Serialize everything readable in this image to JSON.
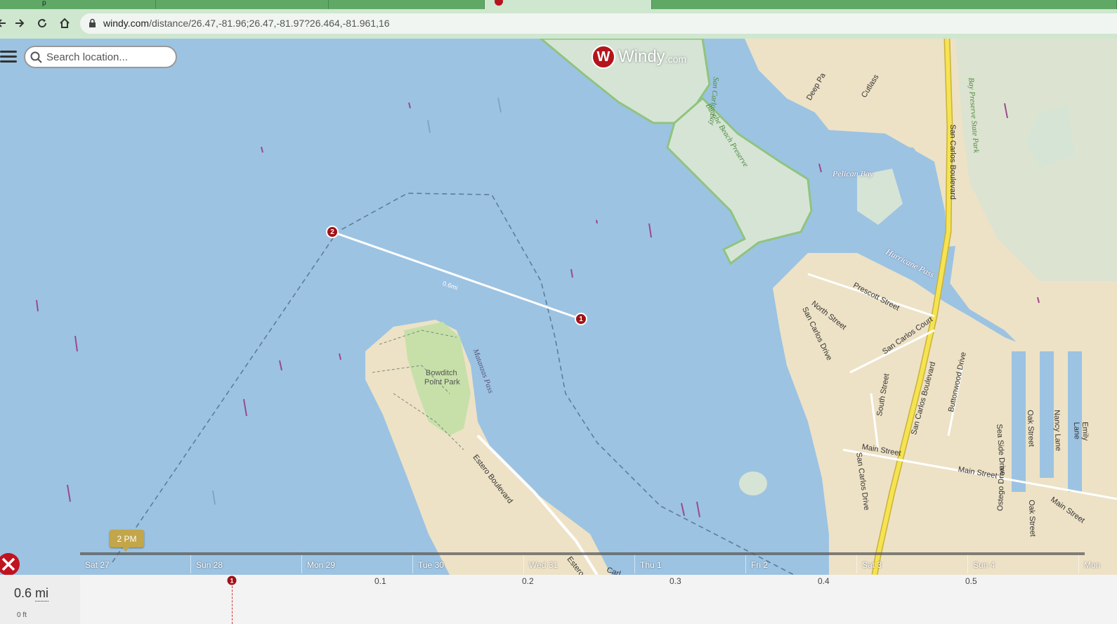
{
  "browser": {
    "tabs": [
      {
        "label": "p"
      },
      {
        "label": ""
      },
      {
        "label": ""
      },
      {
        "label": ""
      },
      {
        "label": ""
      }
    ],
    "url_host": "windy.com",
    "url_path": "/distance/26.47,-81.96;26.47,-81.97?26.464,-81.961,16"
  },
  "map": {
    "search_placeholder": "Search location...",
    "logo_text": "Windy",
    "logo_suffix": ".com",
    "line_distance_label": "0.6mi",
    "marker1": "1",
    "marker2": "2",
    "place_labels": {
      "bowditch": "Bowditch",
      "point_park": "Point Park",
      "matanzas_pass": "Matanzas Pass",
      "estero_blvd": "Estero Boulevard",
      "estero": "Estero",
      "pelican_bay": "Pelican Bay",
      "hurricane_pass": "Hurricane Pass",
      "san_carlos_bay": "San Carlos Bay",
      "bunche_beach": "Bunche Beach Preserve",
      "bay_preserve": "Bay Preserve State Park",
      "san_carlos_blvd_north": "San Carlos Boulevard",
      "san_carlos_blvd_south": "San Carlos Boulevard",
      "prescott_st": "Prescott Street",
      "north_st": "North Street",
      "san_carlos_court": "San Carlos Court",
      "san_carlos_drive": "San Carlos Drive",
      "san_carlos_drive2": "San Carlos Drive",
      "south_st": "South Street",
      "main_st": "Main Street",
      "main_st2": "Main Street",
      "main_st3": "Main Street",
      "buttonwood": "Buttonwood Drive",
      "oak_st": "Oak Street",
      "oak_st2": "Oak Street",
      "nancy_lane": "Nancy Lane",
      "emily_lane": "Emily Lane",
      "sea_side": "Sea Side Drive",
      "ostego": "Ostego Drive",
      "deep_pass": "Deep Pa",
      "cutlass": "Cutlass",
      "carl": "Carl"
    },
    "time_badge": "2 PM",
    "days": [
      "Sat 27",
      "Sun 28",
      "Mon 29",
      "Tue 30",
      "Wed 31",
      "Thu 1",
      "Fri 2",
      "Sat 3",
      "Sun 4",
      "Mon"
    ]
  },
  "profile": {
    "distance_value": "0.6",
    "distance_unit": "mi",
    "elevation_label": "0 ft",
    "scale": [
      "0.1",
      "0.2",
      "0.3",
      "0.4",
      "0.5"
    ],
    "marker": "1"
  },
  "colors": {
    "water": "#9dc3e2",
    "land": "#eee2c6",
    "park": "#c7e0a9",
    "accent": "#b3151c",
    "badge": "#c3a54a",
    "road_major": "#f5e351"
  }
}
